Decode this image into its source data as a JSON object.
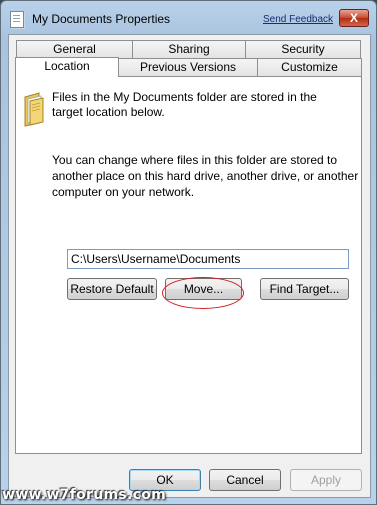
{
  "window": {
    "title": "My Documents Properties",
    "send_feedback": "Send Feedback",
    "close_label": "X"
  },
  "tabs_row1": [
    "General",
    "Sharing",
    "Security"
  ],
  "tabs_row2": [
    "Location",
    "Previous Versions",
    "Customize"
  ],
  "active_tab": "Location",
  "location": {
    "info_line1": "Files in the My Documents folder are stored in the",
    "info_line2": "target location below.",
    "change_line1": "You can change where files in this folder are stored to",
    "change_line2": "another place on this hard drive, another drive, or another",
    "change_line3": "computer on your network.",
    "path_value": "C:\\Users\\Username\\Documents",
    "restore_default": "Restore Default",
    "move": "Move...",
    "find_target": "Find Target..."
  },
  "footer": {
    "ok": "OK",
    "cancel": "Cancel",
    "apply": "Apply"
  },
  "watermark": "www.w7forums.com",
  "colors": {
    "annotation_circle": "#d02020",
    "close_button": "#c9462e",
    "link": "#1a2b6e"
  }
}
